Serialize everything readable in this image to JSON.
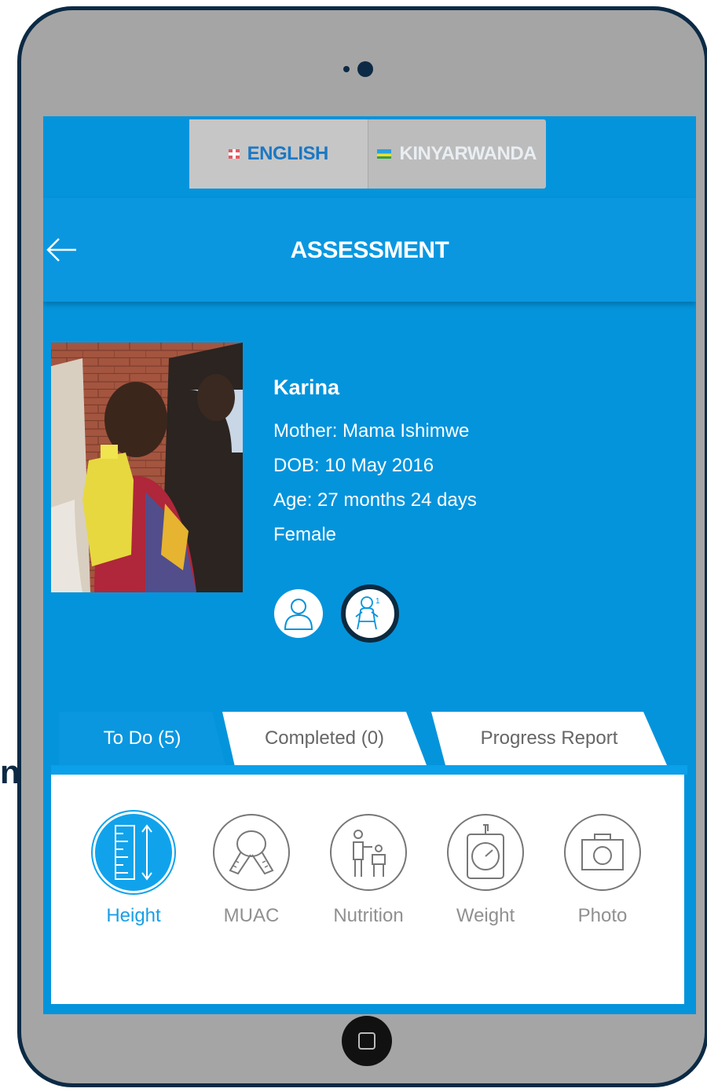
{
  "edge_text": "n",
  "language": {
    "english": "ENGLISH",
    "kinyarwanda": "KINYARWANDA"
  },
  "header": {
    "title": "ASSESSMENT"
  },
  "child": {
    "name": "Karina",
    "mother": "Mother: Mama Ishimwe",
    "dob": "DOB: 10 May 2016",
    "age": "Age: 27 months 24 days",
    "gender": "Female"
  },
  "tabs": [
    {
      "label": "To Do (5)",
      "active": true
    },
    {
      "label": "Completed (0)",
      "active": false
    },
    {
      "label": "Progress Report",
      "active": false
    }
  ],
  "tasks": [
    {
      "label": "Height",
      "icon": "height-icon",
      "active": true
    },
    {
      "label": "MUAC",
      "icon": "measuring-tape-icon",
      "active": false
    },
    {
      "label": "Nutrition",
      "icon": "nutrition-icon",
      "active": false
    },
    {
      "label": "Weight",
      "icon": "scale-icon",
      "active": false
    },
    {
      "label": "Photo",
      "icon": "camera-icon",
      "active": false
    }
  ],
  "colors": {
    "primary": "#0494dc",
    "accent": "#10a3ec",
    "bezel": "#a5a5a5",
    "bezel_border": "#0c2a45"
  }
}
